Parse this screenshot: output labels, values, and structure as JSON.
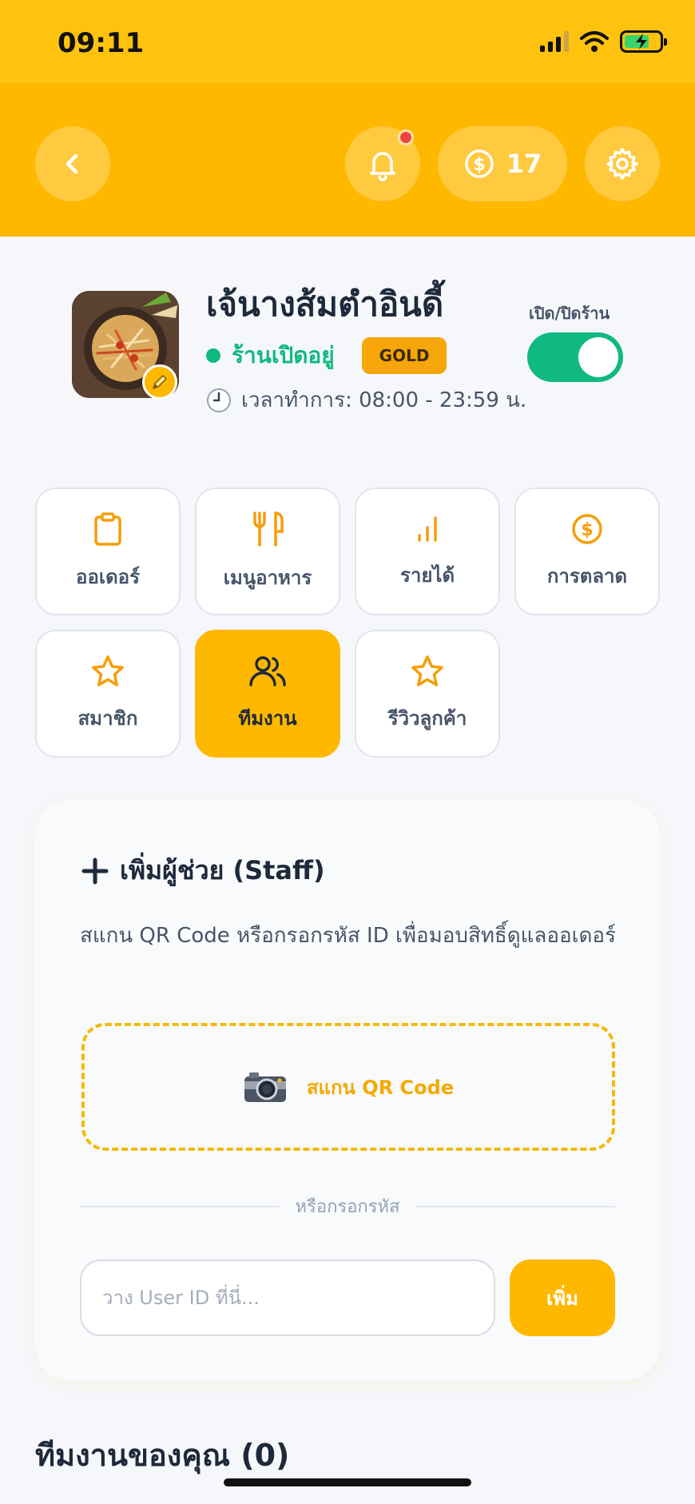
{
  "status_bar": {
    "time": "09:11"
  },
  "header": {
    "back_icon": "chevron-left-icon",
    "bell_icon": "bell-icon",
    "coin_icon": "coin-icon",
    "coin_count": "17",
    "settings_icon": "gear-icon"
  },
  "shop": {
    "name": "เจ้นางส้มตำอินดี้",
    "status": "ร้านเปิดอยู่",
    "tier": "GOLD",
    "hours": "เวลาทำการ: 08:00 - 23:59 น.",
    "toggle_label": "เปิด/ปิดร้าน",
    "is_open": true
  },
  "menu": [
    {
      "label": "ออเดอร์",
      "icon": "clipboard-icon"
    },
    {
      "label": "เมนูอาหาร",
      "icon": "utensils-icon"
    },
    {
      "label": "รายได้",
      "icon": "bar-chart-icon"
    },
    {
      "label": "การตลาด",
      "icon": "dollar-coin-icon"
    },
    {
      "label": "สมาชิก",
      "icon": "star-icon"
    },
    {
      "label": "ทีมงาน",
      "icon": "users-icon",
      "active": true
    },
    {
      "label": "รีวิวลูกค้า",
      "icon": "star-icon"
    }
  ],
  "staff_card": {
    "title": "เพิ่มผู้ช่วย (Staff)",
    "description": "สแกน QR Code หรือกรอกรหัส ID เพื่อมอบสิทธิ์ดูแลออเดอร์",
    "scan_label": "สแกน QR Code",
    "divider_text": "หรือกรอกรหัส",
    "input_placeholder": "วาง User ID ที่นี่...",
    "add_button": "เพิ่ม"
  },
  "team": {
    "title": "ทีมงานของคุณ (0)"
  },
  "colors": {
    "primary": "#ffb800",
    "status_bar": "#ffc20e",
    "success": "#10b981",
    "gold": "#f6a609"
  }
}
